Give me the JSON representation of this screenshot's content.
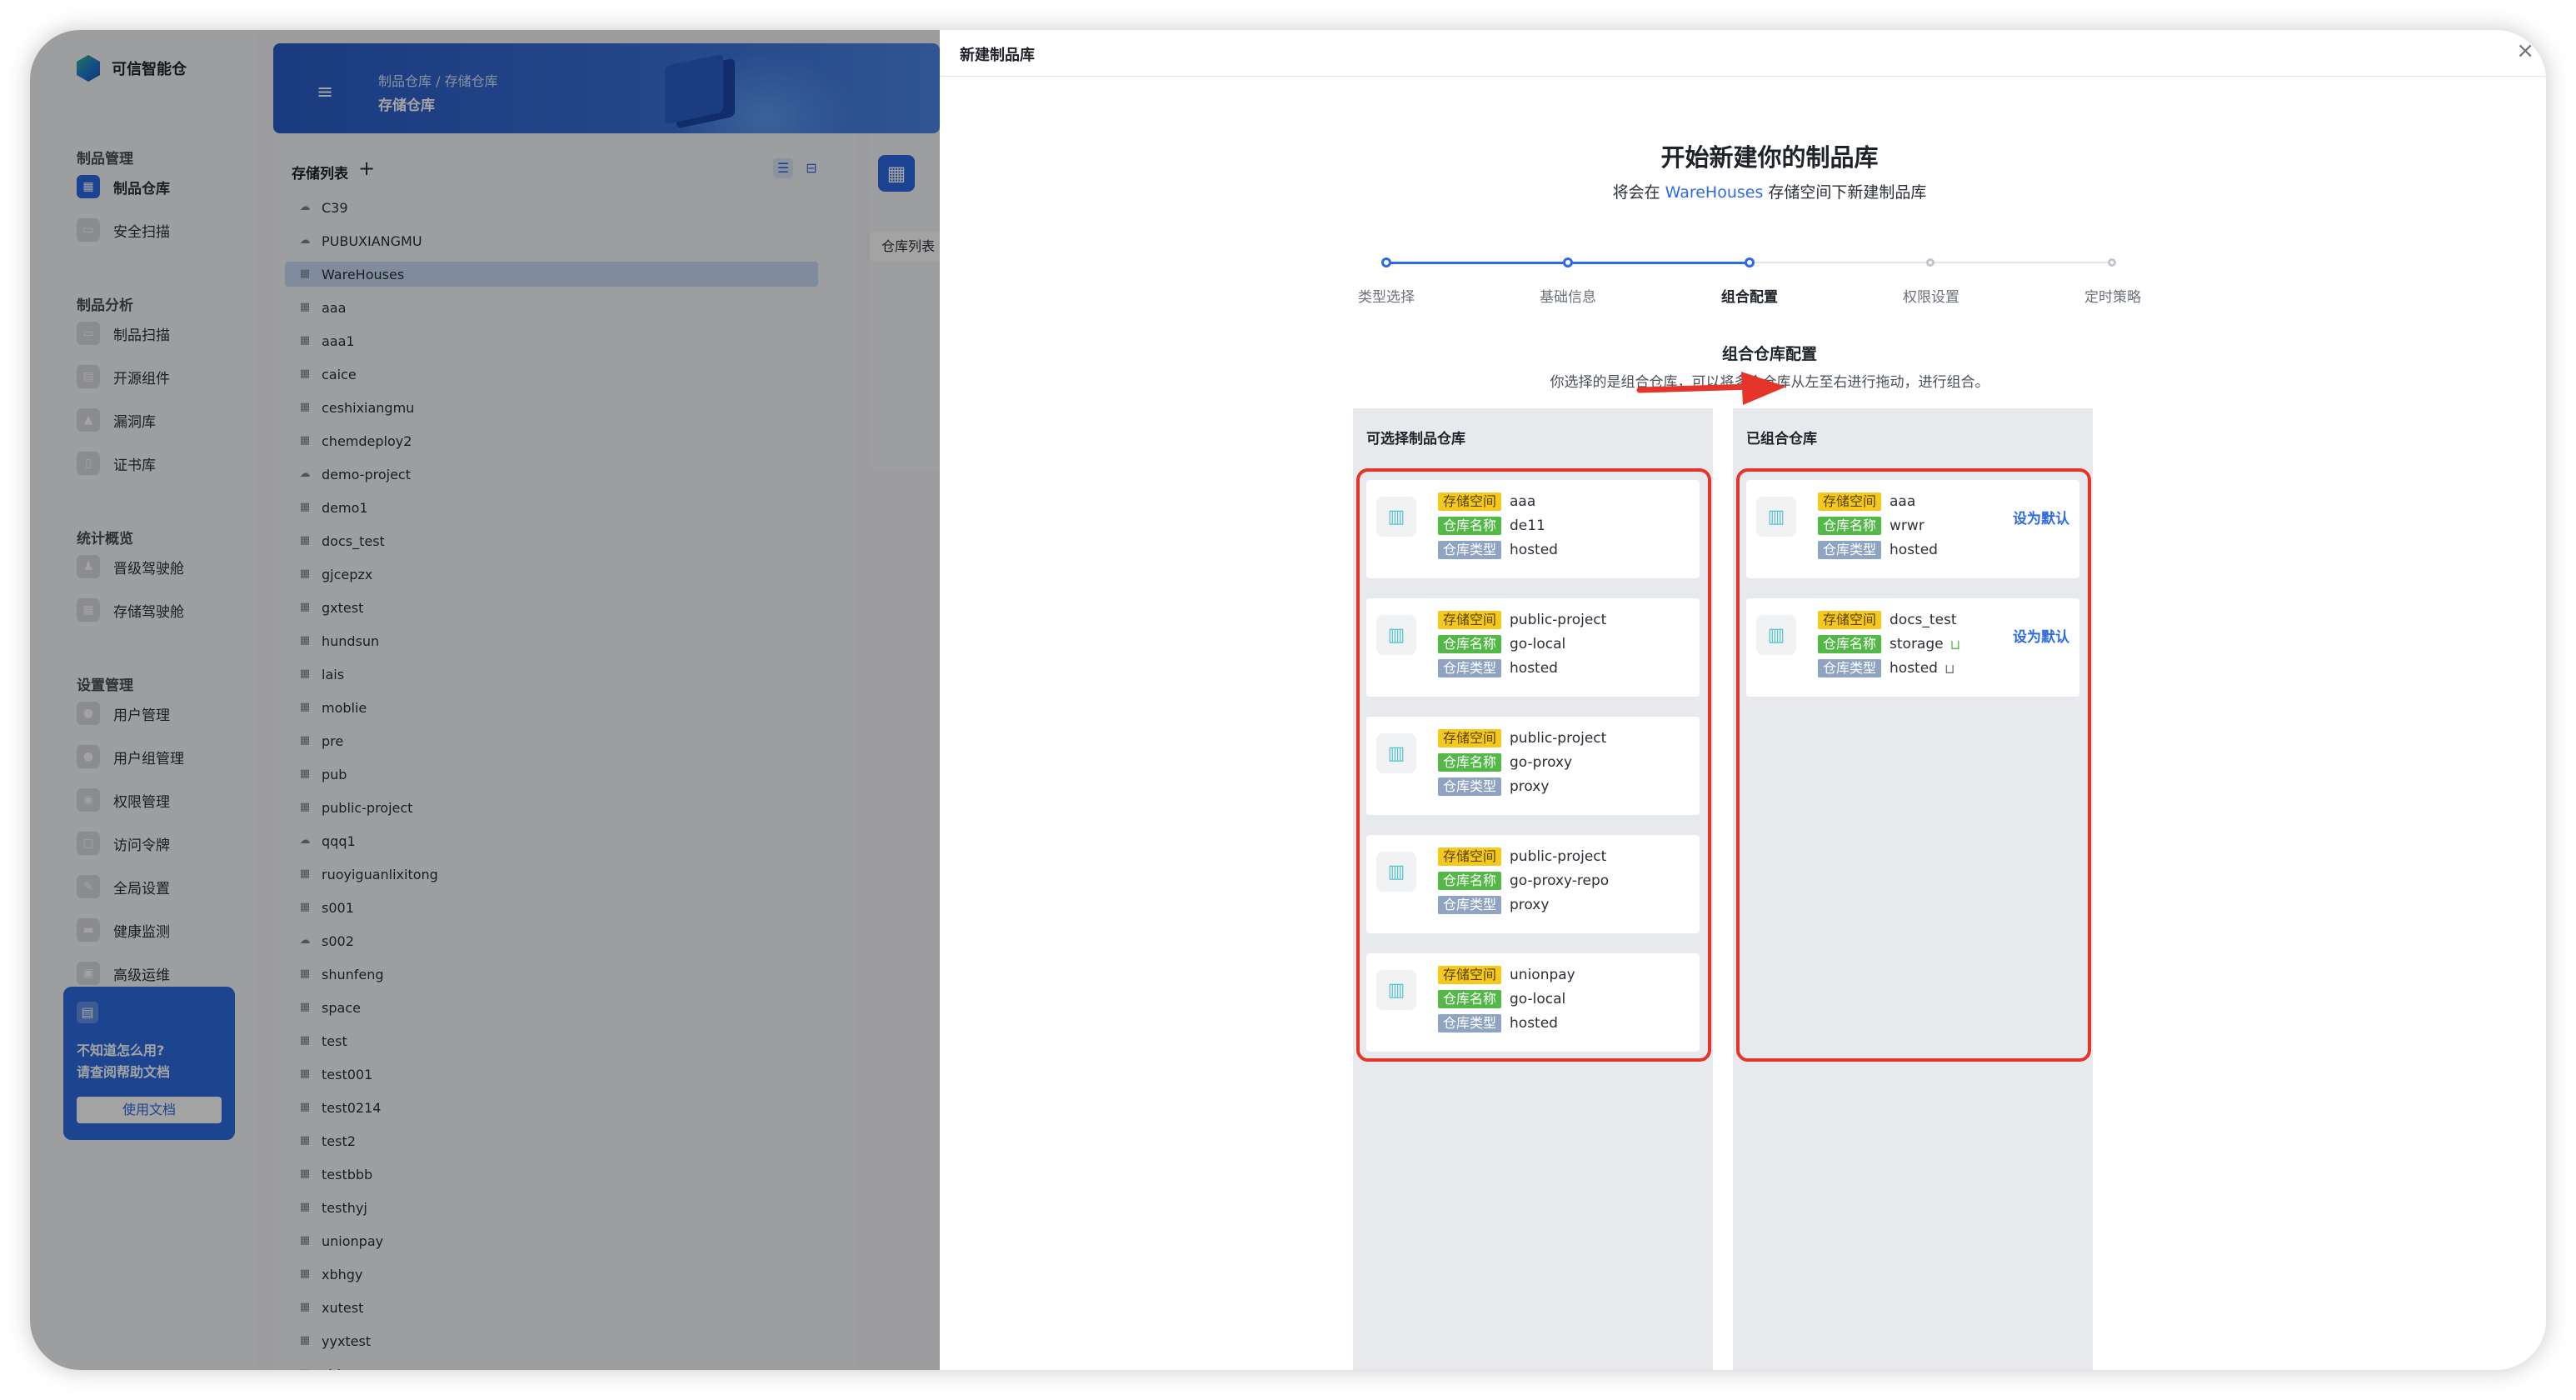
{
  "app": {
    "brand": "可信智能仓"
  },
  "sidebar": {
    "groups": [
      {
        "title": "制品管理",
        "items": [
          {
            "label": "制品仓库",
            "active": true,
            "icon": "grid-icon"
          },
          {
            "label": "安全扫描",
            "icon": "scan-icon"
          }
        ]
      },
      {
        "title": "制品分析",
        "items": [
          {
            "label": "制品扫描",
            "icon": "scan-icon"
          },
          {
            "label": "开源组件",
            "icon": "component-icon"
          },
          {
            "label": "漏洞库",
            "icon": "bug-icon"
          },
          {
            "label": "证书库",
            "icon": "certificate-icon"
          }
        ]
      },
      {
        "title": "统计概览",
        "items": [
          {
            "label": "晋级驾驶舱",
            "icon": "cockpit-icon"
          },
          {
            "label": "存储驾驶舱",
            "icon": "storage-icon"
          }
        ]
      },
      {
        "title": "设置管理",
        "items": [
          {
            "label": "用户管理",
            "icon": "user-icon"
          },
          {
            "label": "用户组管理",
            "icon": "users-icon"
          },
          {
            "label": "权限管理",
            "icon": "permission-icon"
          },
          {
            "label": "访问令牌",
            "icon": "lock-icon"
          },
          {
            "label": "全局设置",
            "icon": "wrench-icon"
          },
          {
            "label": "健康监测",
            "icon": "monitor-icon"
          },
          {
            "label": "高级运维",
            "icon": "ops-icon"
          }
        ]
      }
    ],
    "help": {
      "line1": "不知道怎么用?",
      "line2": "请查阅帮助文档",
      "button": "使用文档"
    }
  },
  "header": {
    "breadcrumb_1": "制品仓库",
    "breadcrumb_sep": "/",
    "breadcrumb_2": "存储仓库",
    "title": "存储仓库"
  },
  "storage_list": {
    "title": "存储列表",
    "items": [
      {
        "label": "C39",
        "icon": "cloud-icon"
      },
      {
        "label": "PUBUXIANGMU",
        "icon": "cloud-icon"
      },
      {
        "label": "WareHouses",
        "icon": "grid-icon",
        "selected": true
      },
      {
        "label": "aaa",
        "icon": "grid-icon"
      },
      {
        "label": "aaa1",
        "icon": "grid-icon"
      },
      {
        "label": "caice",
        "icon": "grid-icon"
      },
      {
        "label": "ceshixiangmu",
        "icon": "grid-icon"
      },
      {
        "label": "chemdeploy2",
        "icon": "grid-icon"
      },
      {
        "label": "demo-project",
        "icon": "cloud-icon"
      },
      {
        "label": "demo1",
        "icon": "grid-icon"
      },
      {
        "label": "docs_test",
        "icon": "grid-icon"
      },
      {
        "label": "gjcepzx",
        "icon": "grid-icon"
      },
      {
        "label": "gxtest",
        "icon": "grid-icon"
      },
      {
        "label": "hundsun",
        "icon": "grid-icon"
      },
      {
        "label": "lais",
        "icon": "grid-icon"
      },
      {
        "label": "moblie",
        "icon": "grid-icon"
      },
      {
        "label": "pre",
        "icon": "grid-icon"
      },
      {
        "label": "pub",
        "icon": "grid-icon"
      },
      {
        "label": "public-project",
        "icon": "grid-icon"
      },
      {
        "label": "qqq1",
        "icon": "cloud-icon"
      },
      {
        "label": "ruoyiguanlixitong",
        "icon": "grid-icon"
      },
      {
        "label": "s001",
        "icon": "grid-icon"
      },
      {
        "label": "s002",
        "icon": "cloud-icon"
      },
      {
        "label": "shunfeng",
        "icon": "grid-icon"
      },
      {
        "label": "space",
        "icon": "grid-icon"
      },
      {
        "label": "test",
        "icon": "grid-icon"
      },
      {
        "label": "test001",
        "icon": "grid-icon"
      },
      {
        "label": "test0214",
        "icon": "grid-icon"
      },
      {
        "label": "test2",
        "icon": "grid-icon"
      },
      {
        "label": "testbbb",
        "icon": "grid-icon"
      },
      {
        "label": "testhyj",
        "icon": "grid-icon"
      },
      {
        "label": "unionpay",
        "icon": "grid-icon"
      },
      {
        "label": "xbhgy",
        "icon": "grid-icon"
      },
      {
        "label": "xutest",
        "icon": "grid-icon"
      },
      {
        "label": "yyxtest",
        "icon": "grid-icon"
      },
      {
        "label": "zhb-",
        "icon": "grid-icon"
      }
    ]
  },
  "info_panel": {
    "tab": "仓库列表"
  },
  "drawer": {
    "title": "新建制品库",
    "heading": "开始新建你的制品库",
    "subtitle_prefix": "将会在 ",
    "subtitle_link": "WareHouses",
    "subtitle_suffix": " 存储空间下新建制品库",
    "steps": [
      {
        "label": "类型选择",
        "state": "done"
      },
      {
        "label": "基础信息",
        "state": "done"
      },
      {
        "label": "组合配置",
        "state": "active"
      },
      {
        "label": "权限设置",
        "state": "pending"
      },
      {
        "label": "定时策略",
        "state": "pending"
      }
    ],
    "config_title": "组合仓库配置",
    "config_desc": "你选择的是组合仓库，可以将多个仓库从左至右进行拖动，进行组合。",
    "tag_labels": {
      "space": "存储空间",
      "name": "仓库名称",
      "type": "仓库类型"
    },
    "available": {
      "title": "可选择制品仓库",
      "repos": [
        {
          "space": "aaa",
          "name": "de11",
          "type": "hosted"
        },
        {
          "space": "public-project",
          "name": "go-local",
          "type": "hosted"
        },
        {
          "space": "public-project",
          "name": "go-proxy",
          "type": "proxy"
        },
        {
          "space": "public-project",
          "name": "go-proxy-repo",
          "type": "proxy"
        },
        {
          "space": "unionpay",
          "name": "go-local",
          "type": "hosted"
        }
      ]
    },
    "combined": {
      "title": "已组合仓库",
      "set_default": "设为默认",
      "repos": [
        {
          "space": "aaa",
          "name": "wrwr",
          "type": "hosted",
          "locks": false
        },
        {
          "space": "docs_test",
          "name": "storage",
          "type": "hosted",
          "locks": true
        }
      ]
    },
    "colors": {
      "highlight": "#e5352b",
      "accent": "#2d6ae3"
    }
  }
}
